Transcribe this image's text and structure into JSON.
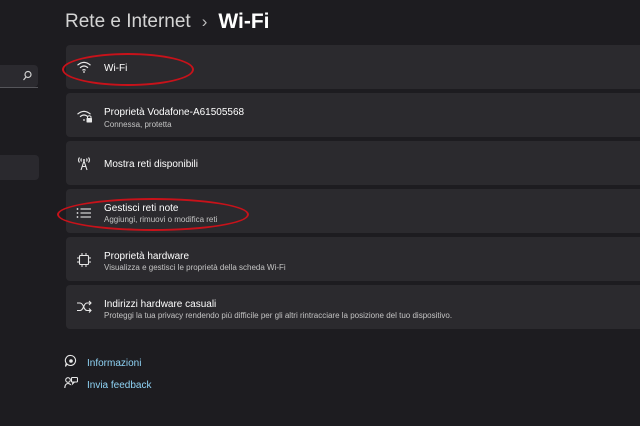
{
  "breadcrumb": {
    "parent": "Rete e Internet",
    "separator": "›",
    "current": "Wi-Fi"
  },
  "items": [
    {
      "title": "Wi-Fi",
      "icon": "wifi-icon"
    },
    {
      "title": "Proprietà Vodafone-A61505568",
      "subtitle": "Connessa, protetta",
      "icon": "wifi-secure-icon"
    },
    {
      "title": "Mostra reti disponibili",
      "icon": "antenna-icon"
    },
    {
      "title": "Gestisci reti note",
      "subtitle": "Aggiungi, rimuovi o modifica reti",
      "icon": "list-icon"
    },
    {
      "title": "Proprietà hardware",
      "subtitle": "Visualizza e gestisci le proprietà della scheda Wi-Fi",
      "icon": "chip-icon"
    },
    {
      "title": "Indirizzi hardware casuali",
      "subtitle": "Proteggi la tua privacy rendendo più difficile per gli altri rintracciare la posizione del tuo dispositivo.",
      "icon": "shuffle-icon"
    }
  ],
  "footer_links": [
    {
      "label": "Informazioni",
      "icon": "help-chat-icon"
    },
    {
      "label": "Invia feedback",
      "icon": "feedback-icon"
    }
  ],
  "colors": {
    "background": "#1d1c20",
    "card": "#2b2a2e",
    "link": "#8fd3f5",
    "annotation": "#c8121a"
  }
}
